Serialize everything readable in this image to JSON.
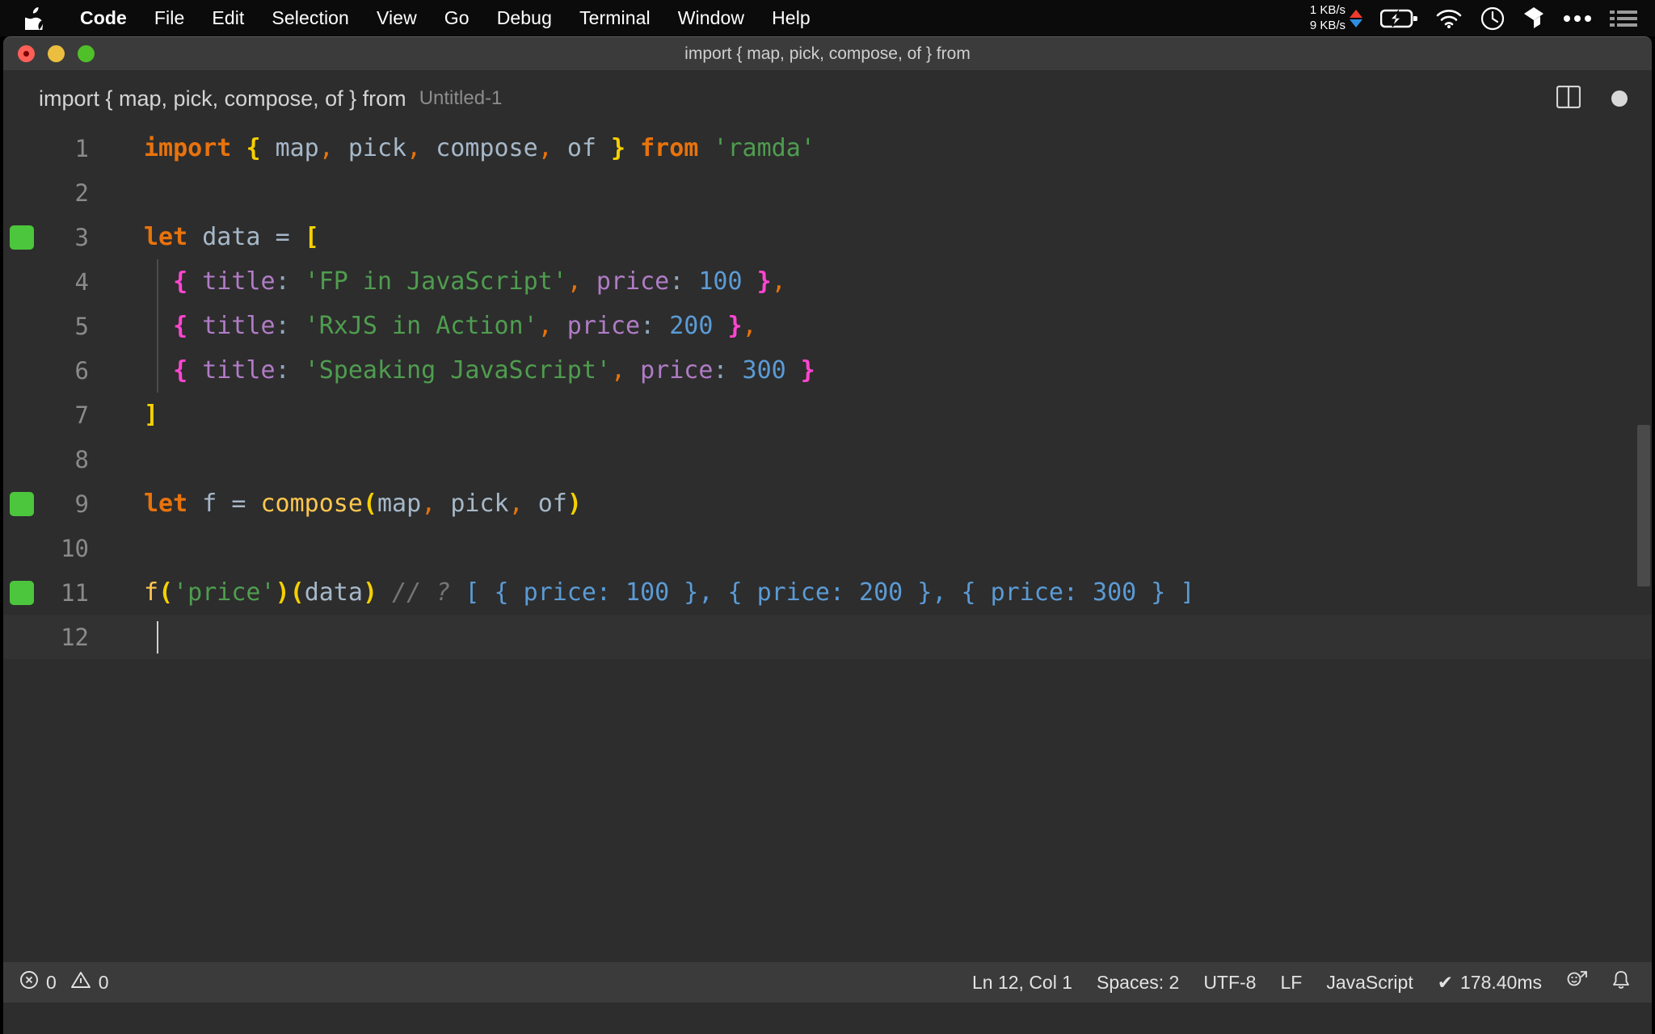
{
  "menubar": {
    "apple_icon": "apple-logo-icon",
    "items": [
      {
        "label": "Code",
        "bold": true
      },
      {
        "label": "File",
        "bold": false
      },
      {
        "label": "Edit",
        "bold": false
      },
      {
        "label": "Selection",
        "bold": false
      },
      {
        "label": "View",
        "bold": false
      },
      {
        "label": "Go",
        "bold": false
      },
      {
        "label": "Debug",
        "bold": false
      },
      {
        "label": "Terminal",
        "bold": false
      },
      {
        "label": "Window",
        "bold": false
      },
      {
        "label": "Help",
        "bold": false
      }
    ],
    "network": {
      "upload": "1 KB/s",
      "download": "9 KB/s"
    },
    "status_icons": [
      "battery-charging-icon",
      "wifi-icon",
      "clock-icon",
      "dropbox-icon",
      "ellipsis-icon",
      "control-center-list-icon"
    ]
  },
  "window": {
    "title": "import { map, pick, compose, of } from",
    "traffic_lights": [
      "close-button",
      "minimize-button",
      "maximize-button"
    ]
  },
  "tab": {
    "title": "import { map, pick, compose, of } from",
    "filename": "Untitled-1",
    "split_editor_icon": "split-editor-icon",
    "dirty_indicator": "unsaved-dot-icon"
  },
  "editor": {
    "language": "JavaScript",
    "lines": [
      {
        "num": "1",
        "marker": false,
        "tokens": [
          {
            "t": "import",
            "c": "t-kw"
          },
          {
            "t": " ",
            "c": "t-id"
          },
          {
            "t": "{",
            "c": "t-brace-y"
          },
          {
            "t": " ",
            "c": "t-id"
          },
          {
            "t": "map",
            "c": "t-id"
          },
          {
            "t": ",",
            "c": "t-punc"
          },
          {
            "t": " ",
            "c": "t-id"
          },
          {
            "t": "pick",
            "c": "t-id"
          },
          {
            "t": ",",
            "c": "t-punc"
          },
          {
            "t": " ",
            "c": "t-id"
          },
          {
            "t": "compose",
            "c": "t-id"
          },
          {
            "t": ",",
            "c": "t-punc"
          },
          {
            "t": " ",
            "c": "t-id"
          },
          {
            "t": "of",
            "c": "t-id"
          },
          {
            "t": " ",
            "c": "t-id"
          },
          {
            "t": "}",
            "c": "t-brace-y"
          },
          {
            "t": " ",
            "c": "t-id"
          },
          {
            "t": "from",
            "c": "t-kw"
          },
          {
            "t": " ",
            "c": "t-id"
          },
          {
            "t": "'ramda'",
            "c": "t-str"
          }
        ]
      },
      {
        "num": "2",
        "marker": false,
        "tokens": []
      },
      {
        "num": "3",
        "marker": true,
        "tokens": [
          {
            "t": "let",
            "c": "t-kw"
          },
          {
            "t": " ",
            "c": "t-id"
          },
          {
            "t": "data",
            "c": "t-id"
          },
          {
            "t": " ",
            "c": "t-id"
          },
          {
            "t": "=",
            "c": "t-eq"
          },
          {
            "t": " ",
            "c": "t-id"
          },
          {
            "t": "[",
            "c": "t-brace-y"
          }
        ]
      },
      {
        "num": "4",
        "marker": false,
        "indent": true,
        "tokens": [
          {
            "t": "  ",
            "c": "t-id"
          },
          {
            "t": "{",
            "c": "t-brace-m"
          },
          {
            "t": " ",
            "c": "t-id"
          },
          {
            "t": "title",
            "c": "t-key"
          },
          {
            "t": ":",
            "c": "t-colon"
          },
          {
            "t": " ",
            "c": "t-id"
          },
          {
            "t": "'FP in JavaScript'",
            "c": "t-str"
          },
          {
            "t": ",",
            "c": "t-punc"
          },
          {
            "t": " ",
            "c": "t-id"
          },
          {
            "t": "price",
            "c": "t-key"
          },
          {
            "t": ":",
            "c": "t-colon"
          },
          {
            "t": " ",
            "c": "t-id"
          },
          {
            "t": "100",
            "c": "t-num"
          },
          {
            "t": " ",
            "c": "t-id"
          },
          {
            "t": "}",
            "c": "t-brace-m"
          },
          {
            "t": ",",
            "c": "t-punc"
          }
        ]
      },
      {
        "num": "5",
        "marker": false,
        "indent": true,
        "tokens": [
          {
            "t": "  ",
            "c": "t-id"
          },
          {
            "t": "{",
            "c": "t-brace-m"
          },
          {
            "t": " ",
            "c": "t-id"
          },
          {
            "t": "title",
            "c": "t-key"
          },
          {
            "t": ":",
            "c": "t-colon"
          },
          {
            "t": " ",
            "c": "t-id"
          },
          {
            "t": "'RxJS in Action'",
            "c": "t-str"
          },
          {
            "t": ",",
            "c": "t-punc"
          },
          {
            "t": " ",
            "c": "t-id"
          },
          {
            "t": "price",
            "c": "t-key"
          },
          {
            "t": ":",
            "c": "t-colon"
          },
          {
            "t": " ",
            "c": "t-id"
          },
          {
            "t": "200",
            "c": "t-num"
          },
          {
            "t": " ",
            "c": "t-id"
          },
          {
            "t": "}",
            "c": "t-brace-m"
          },
          {
            "t": ",",
            "c": "t-punc"
          }
        ]
      },
      {
        "num": "6",
        "marker": false,
        "indent": true,
        "tokens": [
          {
            "t": "  ",
            "c": "t-id"
          },
          {
            "t": "{",
            "c": "t-brace-m"
          },
          {
            "t": " ",
            "c": "t-id"
          },
          {
            "t": "title",
            "c": "t-key"
          },
          {
            "t": ":",
            "c": "t-colon"
          },
          {
            "t": " ",
            "c": "t-id"
          },
          {
            "t": "'Speaking JavaScript'",
            "c": "t-str"
          },
          {
            "t": ",",
            "c": "t-punc"
          },
          {
            "t": " ",
            "c": "t-id"
          },
          {
            "t": "price",
            "c": "t-key"
          },
          {
            "t": ":",
            "c": "t-colon"
          },
          {
            "t": " ",
            "c": "t-id"
          },
          {
            "t": "300",
            "c": "t-num"
          },
          {
            "t": " ",
            "c": "t-id"
          },
          {
            "t": "}",
            "c": "t-brace-m"
          }
        ]
      },
      {
        "num": "7",
        "marker": false,
        "tokens": [
          {
            "t": "]",
            "c": "t-brace-y"
          }
        ]
      },
      {
        "num": "8",
        "marker": false,
        "tokens": []
      },
      {
        "num": "9",
        "marker": true,
        "tokens": [
          {
            "t": "let",
            "c": "t-kw"
          },
          {
            "t": " ",
            "c": "t-id"
          },
          {
            "t": "f",
            "c": "t-id"
          },
          {
            "t": " ",
            "c": "t-id"
          },
          {
            "t": "=",
            "c": "t-eq"
          },
          {
            "t": " ",
            "c": "t-id"
          },
          {
            "t": "compose",
            "c": "t-fn"
          },
          {
            "t": "(",
            "c": "t-paren-y"
          },
          {
            "t": "map",
            "c": "t-id"
          },
          {
            "t": ",",
            "c": "t-punc"
          },
          {
            "t": " ",
            "c": "t-id"
          },
          {
            "t": "pick",
            "c": "t-id"
          },
          {
            "t": ",",
            "c": "t-punc"
          },
          {
            "t": " ",
            "c": "t-id"
          },
          {
            "t": "of",
            "c": "t-id"
          },
          {
            "t": ")",
            "c": "t-paren-y"
          }
        ]
      },
      {
        "num": "10",
        "marker": false,
        "tokens": []
      },
      {
        "num": "11",
        "marker": true,
        "tokens": [
          {
            "t": "f",
            "c": "t-fn"
          },
          {
            "t": "(",
            "c": "t-paren-y"
          },
          {
            "t": "'price'",
            "c": "t-str"
          },
          {
            "t": ")",
            "c": "t-paren-y"
          },
          {
            "t": "(",
            "c": "t-paren-y"
          },
          {
            "t": "data",
            "c": "t-id"
          },
          {
            "t": ")",
            "c": "t-paren-y"
          },
          {
            "t": " ",
            "c": "t-id"
          },
          {
            "t": "// ?",
            "c": "t-com"
          },
          {
            "t": " ",
            "c": "t-id"
          },
          {
            "t": "[ { price: 100 }, { price: 200 }, { price: 300 } ]",
            "c": "t-num"
          }
        ]
      },
      {
        "num": "12",
        "marker": false,
        "current": true,
        "tokens": []
      }
    ]
  },
  "statusbar": {
    "errors_icon": "error-circle-icon",
    "errors": "0",
    "warnings_icon": "warning-triangle-icon",
    "warnings": "0",
    "position": "Ln 12, Col 1",
    "indentation": "Spaces: 2",
    "encoding": "UTF-8",
    "eol": "LF",
    "language": "JavaScript",
    "quokka_check": "✔",
    "quokka_time": "178.40ms",
    "feedback_icon": "feedback-smiley-icon",
    "notifications_icon": "bell-icon"
  },
  "colors": {
    "menubar_bg": "#0b0b0b",
    "titlebar_bg": "#3b3b3b",
    "editor_bg": "#2d2d2d",
    "statusbar_bg": "#3b3b3b",
    "gutter_marker": "#4cc63c",
    "keyword": "#e8730c",
    "string": "#4f9d4f",
    "number": "#5b9bd5",
    "key": "#b07cc6",
    "function": "#ffc74e",
    "brace_yellow": "#f5d000",
    "brace_magenta": "#ff45d0",
    "comment": "#757575"
  }
}
